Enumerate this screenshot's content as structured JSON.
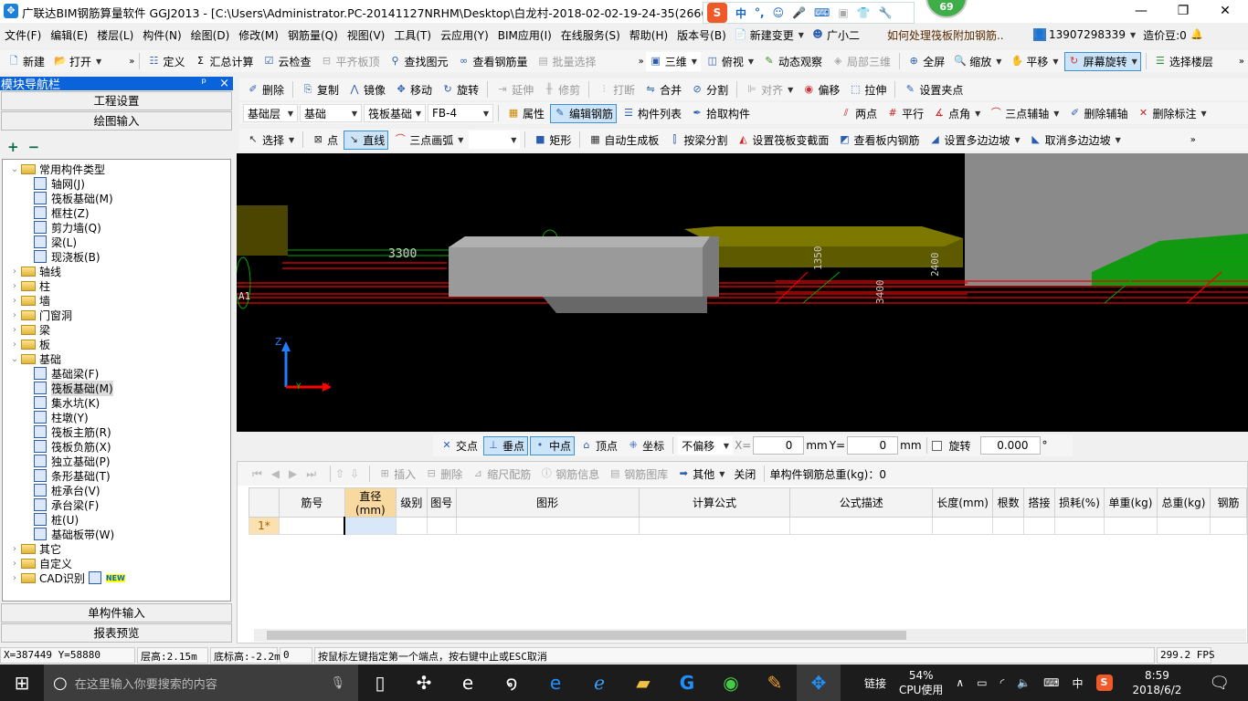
{
  "titlebar": {
    "title": "广联达BIM钢筋算量软件 GGJ2013 - [C:\\Users\\Administrator.PC-20141127NRHM\\Desktop\\白龙村-2018-02-02-19-24-35(2666版).GGJ12]",
    "ime_lang": "中",
    "ime_punct": "°,",
    "badge": "69",
    "minimize": "—",
    "restore": "❐",
    "close": "✕"
  },
  "menu": [
    "文件(F)",
    "编辑(E)",
    "楼层(L)",
    "构件(N)",
    "绘图(D)",
    "修改(M)",
    "钢筋量(Q)",
    "视图(V)",
    "工具(T)",
    "云应用(Y)",
    "BIM应用(I)",
    "在线服务(S)",
    "帮助(H)",
    "版本号(B)"
  ],
  "menu_right": {
    "new_change": "新建变更",
    "assistant": "广小二",
    "tip": "如何处理筏板附加钢筋..",
    "phone": "13907298339",
    "beans": "造价豆:0"
  },
  "toolbar1": {
    "new": "新建",
    "open": "打开",
    "define": "定义",
    "sum": "汇总计算",
    "cloud_check": "云检查",
    "align_top": "平齐板顶",
    "find": "查找图元",
    "view_rebar": "查看钢筋量",
    "batch": "批量选择",
    "three_d": "三维",
    "top_view": "俯视",
    "dynamic": "动态观察",
    "local_3d": "局部三维",
    "fullscreen": "全屏",
    "zoom": "缩放",
    "pan": "平移",
    "rotate": "屏幕旋转",
    "select_floor": "选择楼层"
  },
  "toolbar2": {
    "delete": "删除",
    "copy": "复制",
    "mirror": "镜像",
    "move": "移动",
    "rotate": "旋转",
    "extend": "延伸",
    "trim": "修剪",
    "break": "打断",
    "merge": "合并",
    "split": "分割",
    "align": "对齐",
    "offset": "偏移",
    "stretch": "拉伸",
    "grip": "设置夹点"
  },
  "toolbar3": {
    "floor": "基础层",
    "category": "基础",
    "type": "筏板基础",
    "component": "FB-4",
    "props": "属性",
    "edit_rebar": "编辑钢筋",
    "list": "构件列表",
    "pick": "拾取构件",
    "two_point": "两点",
    "parallel": "平行",
    "point_angle": "点角",
    "three_axis": "三点辅轴",
    "del_axis": "删除辅轴",
    "del_dim": "删除标注"
  },
  "toolbar4": {
    "select": "选择",
    "point": "点",
    "line": "直线",
    "arc": "三点画弧",
    "rect": "矩形",
    "auto_slab": "自动生成板",
    "split_beam": "按梁分割",
    "set_section": "设置筏板变截面",
    "view_slab_rebar": "查看板内钢筋",
    "set_slope": "设置多边边坡",
    "cancel_slope": "取消多边边坡"
  },
  "nav": {
    "header": "模块导航栏",
    "pin": "ᵖ",
    "close": "×",
    "project_settings": "工程设置",
    "drawing_input": "绘图输入",
    "single_input": "单构件输入",
    "report": "报表预览",
    "expand": "+",
    "collapse": "−",
    "tree": [
      {
        "level": 0,
        "open": true,
        "folder": true,
        "label": "常用构件类型"
      },
      {
        "level": 1,
        "label": "轴网(J)"
      },
      {
        "level": 1,
        "label": "筏板基础(M)"
      },
      {
        "level": 1,
        "label": "框柱(Z)"
      },
      {
        "level": 1,
        "label": "剪力墙(Q)"
      },
      {
        "level": 1,
        "label": "梁(L)"
      },
      {
        "level": 1,
        "label": "现浇板(B)"
      },
      {
        "level": 0,
        "folder": true,
        "label": "轴线"
      },
      {
        "level": 0,
        "folder": true,
        "label": "柱"
      },
      {
        "level": 0,
        "folder": true,
        "label": "墙"
      },
      {
        "level": 0,
        "folder": true,
        "label": "门窗洞"
      },
      {
        "level": 0,
        "folder": true,
        "label": "梁"
      },
      {
        "level": 0,
        "folder": true,
        "label": "板"
      },
      {
        "level": 0,
        "open": true,
        "folder": true,
        "label": "基础"
      },
      {
        "level": 1,
        "label": "基础梁(F)"
      },
      {
        "level": 1,
        "label": "筏板基础(M)",
        "selected": true
      },
      {
        "level": 1,
        "label": "集水坑(K)"
      },
      {
        "level": 1,
        "label": "柱墩(Y)"
      },
      {
        "level": 1,
        "label": "筏板主筋(R)"
      },
      {
        "level": 1,
        "label": "筏板负筋(X)"
      },
      {
        "level": 1,
        "label": "独立基础(P)"
      },
      {
        "level": 1,
        "label": "条形基础(T)"
      },
      {
        "level": 1,
        "label": "桩承台(V)"
      },
      {
        "level": 1,
        "label": "承台梁(F)"
      },
      {
        "level": 1,
        "label": "桩(U)"
      },
      {
        "level": 1,
        "label": "基础板带(W)"
      },
      {
        "level": 0,
        "folder": true,
        "label": "其它"
      },
      {
        "level": 0,
        "folder": true,
        "label": "自定义"
      },
      {
        "level": 0,
        "folder": true,
        "label": "CAD识别",
        "new": "NEW"
      }
    ]
  },
  "viewport": {
    "dim_label": "3300",
    "axis_label": "A1",
    "axis_z": "Z",
    "axis_y": "Y",
    "axis_x": "X",
    "dims": [
      "1350",
      "3400",
      "2400"
    ]
  },
  "snap": {
    "intersect": "交点",
    "perp": "垂点",
    "mid": "中点",
    "vertex": "顶点",
    "coord": "坐标",
    "offset_mode": "不偏移",
    "x_label": "X=",
    "x": "0",
    "mm": "mm",
    "y_label": "Y=",
    "y": "0",
    "rotate": "旋转",
    "angle": "0.000",
    "deg": "°"
  },
  "rebar": {
    "insert": "插入",
    "delete": "删除",
    "scale": "缩尺配筋",
    "info": "钢筋信息",
    "library": "钢筋图库",
    "other": "其他",
    "close": "关闭",
    "total": "单构件钢筋总重(kg)：0",
    "columns": [
      "筋号",
      "直径(mm)",
      "级别",
      "图号",
      "图形",
      "计算公式",
      "公式描述",
      "长度(mm)",
      "根数",
      "搭接",
      "损耗(%)",
      "单重(kg)",
      "总重(kg)",
      "钢筋"
    ],
    "rows": [
      {
        "index": "1*"
      }
    ]
  },
  "status": {
    "coords": "X=387449 Y=58880",
    "floor_height": "层高:2.15m",
    "bottom": "底标高:-2.2m",
    "value": "0",
    "hint": "按鼠标左键指定第一个端点，按右键中止或ESC取消",
    "fps": "299.2 FPS"
  },
  "taskbar": {
    "search_placeholder": "在这里输入你要搜索的内容",
    "link": "链接",
    "cpu_pct": "54%",
    "cpu_label": "CPU使用",
    "ime": "中",
    "time": "8:59",
    "date": "2018/6/2"
  },
  "colors": {
    "accent": "#0b63dc",
    "viewport_bg": "#000000",
    "rebar_red": "#ff0000",
    "slab_olive": "#6e6c00"
  }
}
